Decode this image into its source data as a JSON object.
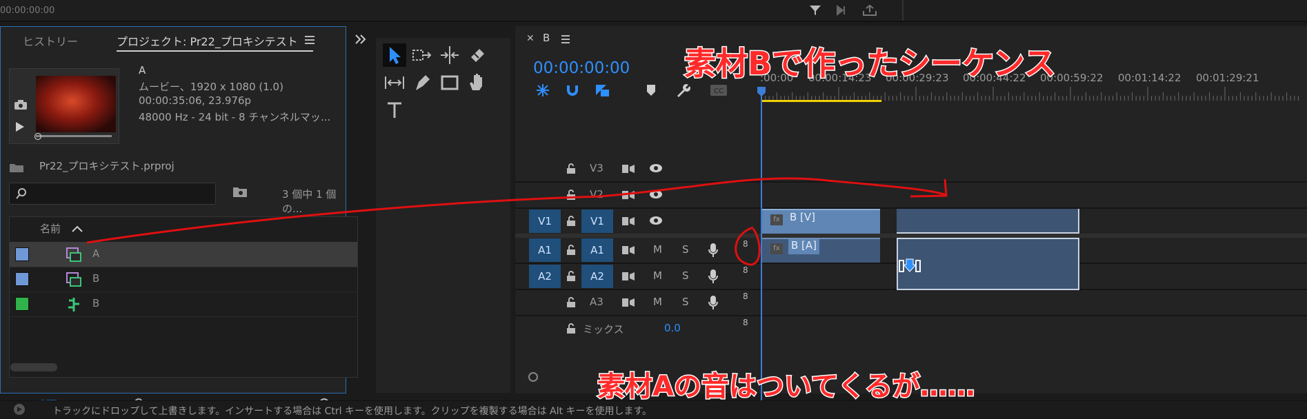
{
  "top": {
    "timecode": "00:00:00:00"
  },
  "project_panel": {
    "tabs": [
      "ヒストリー",
      "プロジェクト: Pr22_プロキシテスト"
    ],
    "clip": {
      "name": "A",
      "line1": "ムービー、1920 x 1080 (1.0)",
      "line2": "00:00:35:06, 23.976p",
      "line3": "48000 Hz - 24 bit - 8 チャンネルマッ..."
    },
    "project_file": "Pr22_プロキシテスト.prproj",
    "search_placeholder": "",
    "selection_count": "3 個中 1 個の...",
    "column_name": "名前",
    "items": [
      {
        "name": "A",
        "color": "#6f99d6",
        "icon": "clip-icon"
      },
      {
        "name": "B",
        "color": "#6f99d6",
        "icon": "clip-icon"
      },
      {
        "name": "B",
        "color": "#2fb34a",
        "icon": "sequence-icon"
      }
    ]
  },
  "timeline": {
    "tab_name": "B",
    "timecode": "00:00:00:00",
    "ruler": [
      ":00:00",
      "00:00:14:23",
      "00:00:29:23",
      "00:00:44:22",
      "00:00:59:22",
      "00:01:14:22",
      "00:01:29:21"
    ],
    "tracks": [
      {
        "id": "V3",
        "src": ""
      },
      {
        "id": "V2",
        "src": ""
      },
      {
        "id": "V1",
        "src": "V1"
      },
      {
        "id": "A1",
        "src": "A1",
        "vol": "8"
      },
      {
        "id": "A2",
        "src": "A2",
        "vol": "8"
      },
      {
        "id": "A3",
        "src": "",
        "vol": "8"
      }
    ],
    "track_buttons": {
      "mute": "M",
      "solo": "S"
    },
    "mix": {
      "label": "ミックス",
      "value": "0.0",
      "vol": "8"
    },
    "clips": {
      "video": "B [V]",
      "audio": "B [A]",
      "fx": "fx"
    }
  },
  "status_text": "トラックにドロップして上書きします。インサートする場合は Ctrl キーを使用します。クリップを複製する場合は Alt キーを使用します。",
  "captions": {
    "top": "素材Bで作ったシーケンス",
    "bottom": "素材Aの音はついてくるが……"
  },
  "colors": {
    "accent": "#2e8fff",
    "track_button": "#1f4f7a",
    "annotation": "#ff2a2a"
  }
}
